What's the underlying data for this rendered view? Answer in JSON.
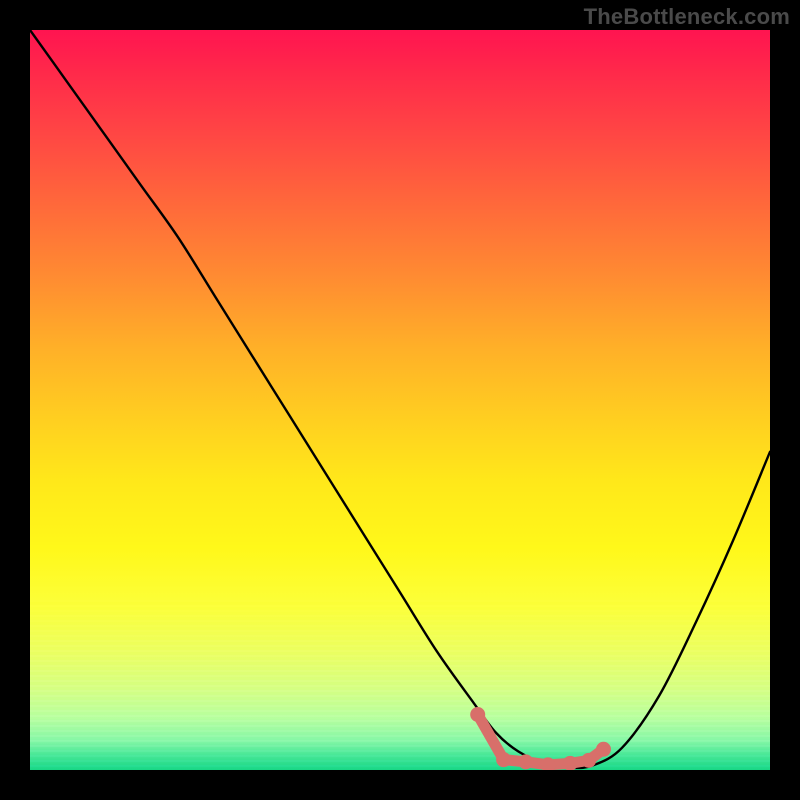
{
  "watermark": "TheBottleneck.com",
  "colors": {
    "background": "#000000",
    "curve_stroke": "#000000",
    "marker_fill": "#d86f6a",
    "watermark_text": "#4a4a4a"
  },
  "chart_data": {
    "type": "line",
    "title": "",
    "xlabel": "",
    "ylabel": "",
    "xlim": [
      0,
      100
    ],
    "ylim": [
      0,
      100
    ],
    "grid": false,
    "legend": false,
    "series": [
      {
        "name": "bottleneck-curve",
        "x": [
          0,
          5,
          10,
          15,
          20,
          25,
          30,
          35,
          40,
          45,
          50,
          55,
          60,
          63,
          66,
          70,
          73,
          76,
          80,
          85,
          90,
          95,
          100
        ],
        "values": [
          100,
          93,
          86,
          79,
          72,
          64,
          56,
          48,
          40,
          32,
          24,
          16,
          9,
          5,
          2.5,
          0.6,
          0.3,
          0.6,
          3,
          10,
          20,
          31,
          43
        ]
      },
      {
        "name": "sweet-spot-markers",
        "x": [
          60.5,
          64,
          67,
          70,
          73,
          75.5,
          77.5
        ],
        "values": [
          7.5,
          1.4,
          1.1,
          0.7,
          0.9,
          1.3,
          2.8
        ]
      }
    ]
  }
}
